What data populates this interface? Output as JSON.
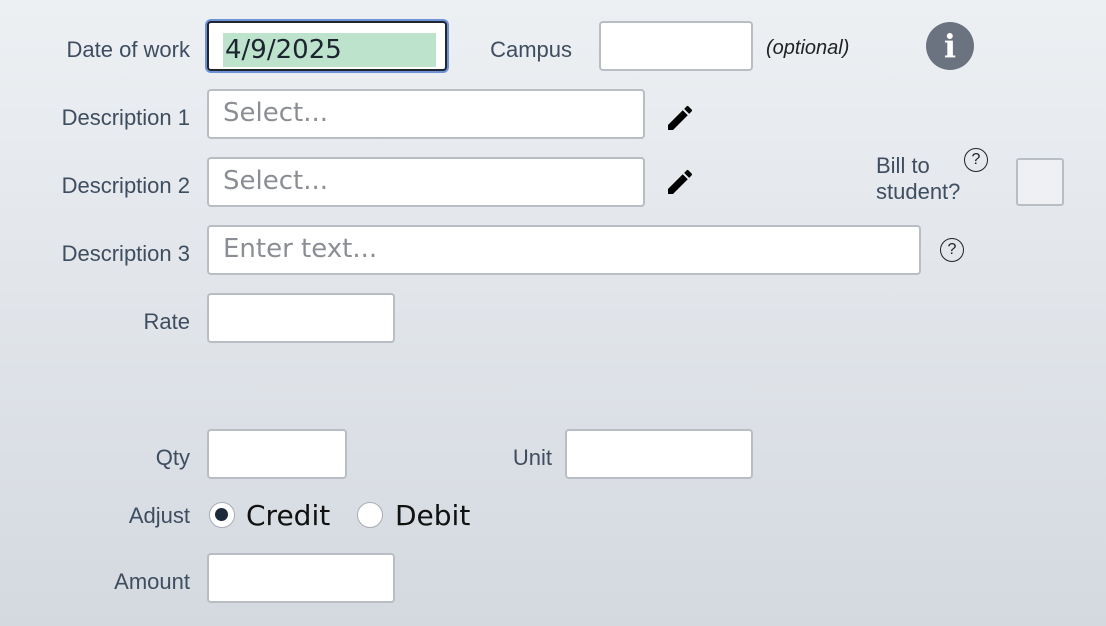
{
  "form": {
    "date_label": "Date of work",
    "date_value": "4/9/2025",
    "campus_label": "Campus",
    "campus_value": "",
    "campus_hint": "(optional)",
    "info_icon_glyph": "i",
    "desc1_label": "Description 1",
    "desc1_placeholder": "Select...",
    "desc2_label": "Description 2",
    "desc2_placeholder": "Select...",
    "desc3_label": "Description 3",
    "desc3_placeholder": "Enter text...",
    "bill_label_line1": "Bill to",
    "bill_label_line2": "student?",
    "bill_checked": false,
    "rate_label": "Rate",
    "rate_value": "",
    "qty_label": "Qty",
    "qty_value": "",
    "unit_label": "Unit",
    "unit_value": "",
    "adjust_label": "Adjust",
    "adjust_options": [
      "Credit",
      "Debit"
    ],
    "adjust_selected": "Credit",
    "amount_label": "Amount",
    "amount_value": "",
    "help_glyph": "?"
  },
  "icons": {
    "edit": "pencil-icon",
    "info": "info-icon",
    "help": "question-circle-icon"
  },
  "colors": {
    "date_highlight": "#bde3cc",
    "focus_ring": "#6d92d6",
    "info_bg": "#6b7380"
  }
}
